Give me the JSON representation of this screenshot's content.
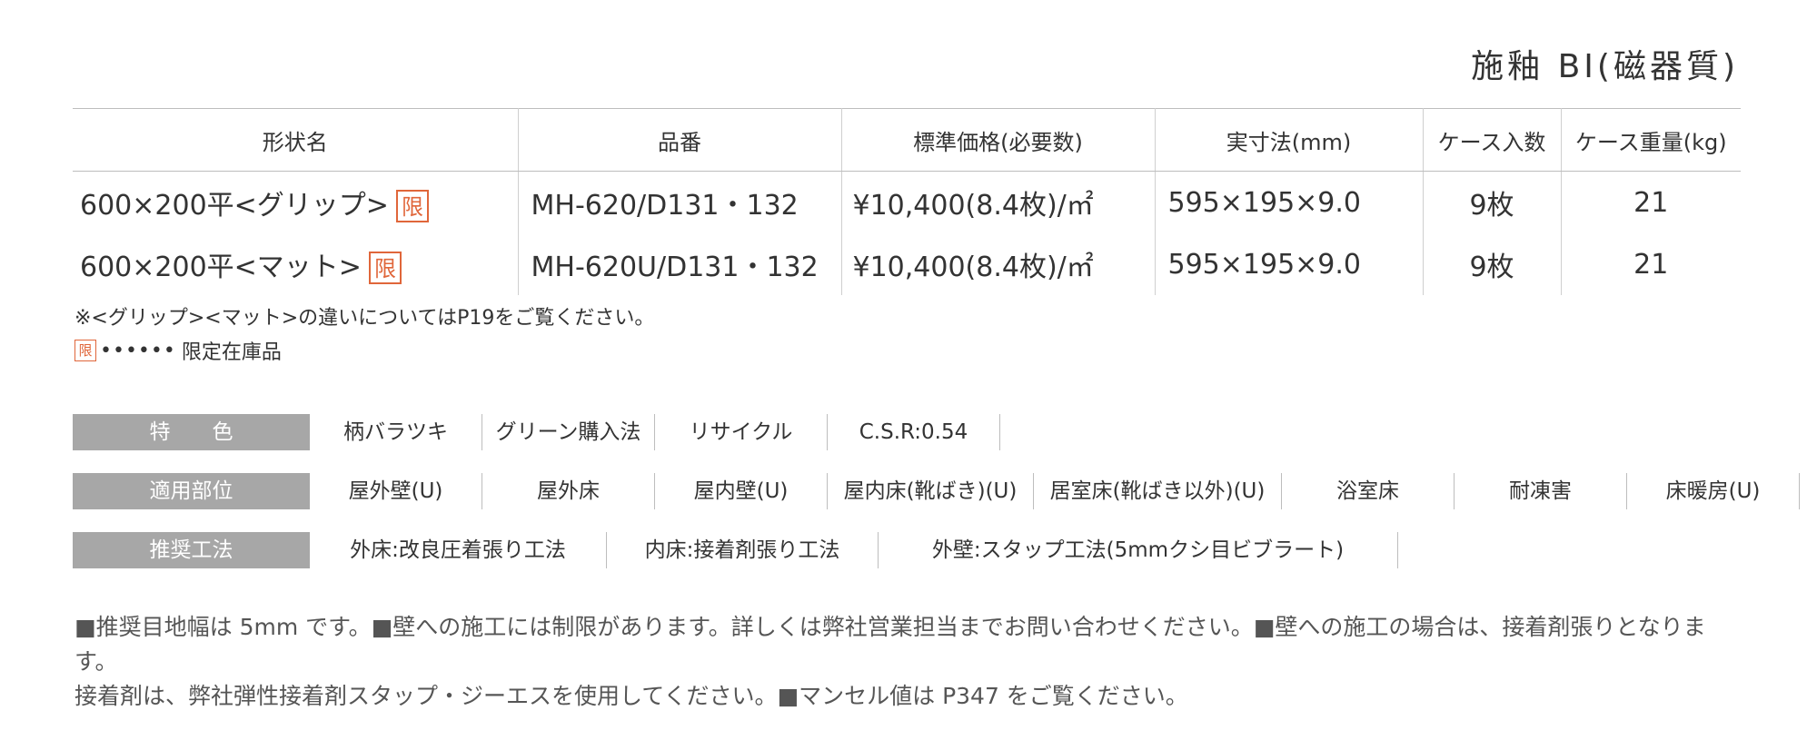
{
  "category_title": "施釉 BI(磁器質)",
  "table": {
    "headers": [
      "形状名",
      "品番",
      "標準価格(必要数)",
      "実寸法(mm)",
      "ケース入数",
      "ケース重量(kg)"
    ],
    "rows": [
      {
        "name": "600×200平<グリップ>",
        "badge": "限",
        "code": "MH-620/D131・132",
        "price": "¥10,400(8.4枚)/㎡",
        "size": "595×195×9.0",
        "qty": "9枚",
        "weight": "21"
      },
      {
        "name": "600×200平<マット>",
        "badge": "限",
        "code": "MH-620U/D131・132",
        "price": "¥10,400(8.4枚)/㎡",
        "size": "595×195×9.0",
        "qty": "9枚",
        "weight": "21"
      }
    ]
  },
  "notes": {
    "line1": "※<グリップ><マット>の違いについてはP19をご覧ください。",
    "badge": "限",
    "dots": "••••••",
    "line2": "限定在庫品"
  },
  "attributes": {
    "features": {
      "label": "特　　色",
      "items": [
        "柄バラツキ",
        "グリーン購入法",
        "リサイクル",
        "C.S.R:0.54"
      ]
    },
    "areas": {
      "label": "適用部位",
      "items": [
        "屋外壁(U)",
        "屋外床",
        "屋内壁(U)",
        "屋内床(靴ばき)(U)",
        "居室床(靴ばき以外)(U)",
        "浴室床",
        "耐凍害",
        "床暖房(U)"
      ]
    },
    "methods": {
      "label": "推奨工法",
      "items": [
        "外床:改良圧着張り工法",
        "内床:接着剤張り工法",
        "外壁:スタップ工法(5mmクシ目ビブラート)"
      ]
    }
  },
  "footer": {
    "line1": "■推奨目地幅は 5mm です。■壁への施工には制限があります。詳しくは弊社営業担当までお問い合わせください。■壁への施工の場合は、接着剤張りとなります。",
    "line2": "接着剤は、弊社弾性接着剤スタップ・ジーエスを使用してください。■マンセル値は P347 をご覧ください。"
  },
  "colors": {
    "badge": "#e0663a",
    "label_bg": "#a7a7a7"
  }
}
